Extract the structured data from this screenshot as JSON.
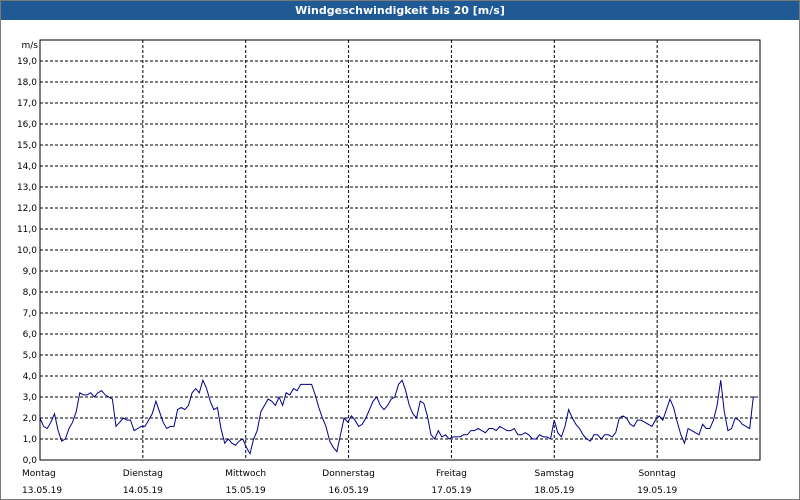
{
  "window": {
    "title": "Windgeschwindigkeit bis 20 [m/s]"
  },
  "chart_data": {
    "type": "line",
    "title": "Windgeschwindigkeit bis 20 [m/s]",
    "ylabel": "m/s",
    "ylim": [
      0,
      20
    ],
    "grid": true,
    "y_ticks": [
      "0,0",
      "1,0",
      "2,0",
      "3,0",
      "4,0",
      "5,0",
      "6,0",
      "7,0",
      "8,0",
      "9,0",
      "10,0",
      "11,0",
      "12,0",
      "13,0",
      "14,0",
      "15,0",
      "16,0",
      "17,0",
      "18,0",
      "19,0"
    ],
    "x_range": [
      0,
      7
    ],
    "x_ticks": [
      {
        "day": "Montag",
        "date": "13.05.19"
      },
      {
        "day": "Dienstag",
        "date": "14.05.19"
      },
      {
        "day": "Mittwoch",
        "date": "15.05.19"
      },
      {
        "day": "Donnerstag",
        "date": "16.05.19"
      },
      {
        "day": "Freitag",
        "date": "17.05.19"
      },
      {
        "day": "Samstag",
        "date": "18.05.19"
      },
      {
        "day": "Sonntag",
        "date": "19.05.19"
      }
    ],
    "series": [
      {
        "color": "#00008b",
        "y": [
          2.0,
          1.6,
          1.5,
          1.8,
          2.2,
          1.4,
          0.9,
          1.0,
          1.5,
          1.8,
          2.3,
          3.2,
          3.1,
          3.1,
          3.2,
          3.0,
          3.2,
          3.3,
          3.1,
          3.0,
          2.9,
          1.6,
          1.8,
          2.0,
          1.9,
          1.9,
          1.4,
          1.5,
          1.6,
          1.6,
          1.9,
          2.2,
          2.8,
          2.3,
          1.8,
          1.5,
          1.6,
          1.6,
          2.4,
          2.5,
          2.4,
          2.6,
          3.2,
          3.4,
          3.2,
          3.8,
          3.4,
          2.8,
          2.4,
          2.5,
          1.5,
          0.8,
          1.0,
          0.8,
          0.7,
          0.9,
          1.0,
          0.6,
          0.3,
          1.0,
          1.4,
          2.3,
          2.6,
          2.9,
          2.8,
          2.6,
          3.0,
          2.6,
          3.2,
          3.1,
          3.4,
          3.3,
          3.6,
          3.6,
          3.6,
          3.6,
          3.1,
          2.5,
          2.0,
          1.6,
          0.9,
          0.6,
          0.4,
          1.2,
          2.0,
          1.8,
          2.1,
          1.9,
          1.6,
          1.7,
          2.0,
          2.4,
          2.8,
          3.0,
          2.6,
          2.4,
          2.6,
          2.9,
          3.0,
          3.6,
          3.8,
          3.3,
          2.6,
          2.2,
          2.0,
          2.8,
          2.7,
          2.1,
          1.2,
          1.0,
          1.4,
          1.1,
          1.2,
          1.0,
          1.1,
          1.1,
          1.1,
          1.2,
          1.2,
          1.4,
          1.4,
          1.5,
          1.4,
          1.3,
          1.5,
          1.5,
          1.4,
          1.6,
          1.5,
          1.4,
          1.4,
          1.5,
          1.2,
          1.2,
          1.3,
          1.2,
          1.0,
          1.0,
          1.2,
          1.1,
          1.1,
          1.0,
          1.9,
          1.3,
          1.1,
          1.6,
          2.4,
          2.0,
          1.7,
          1.5,
          1.2,
          1.0,
          0.9,
          1.2,
          1.2,
          1.0,
          1.2,
          1.2,
          1.1,
          1.3,
          2.0,
          2.1,
          2.0,
          1.7,
          1.6,
          1.9,
          1.9,
          1.8,
          1.7,
          1.6,
          1.9,
          2.1,
          1.9,
          2.4,
          2.9,
          2.5,
          1.8,
          1.2,
          0.8,
          1.5,
          1.4,
          1.3,
          1.2,
          1.7,
          1.5,
          1.5,
          1.9,
          2.6,
          3.8,
          2.3,
          1.4,
          1.5,
          2.0,
          1.9,
          1.7,
          1.6,
          1.5,
          3.0,
          3.0
        ]
      }
    ]
  }
}
